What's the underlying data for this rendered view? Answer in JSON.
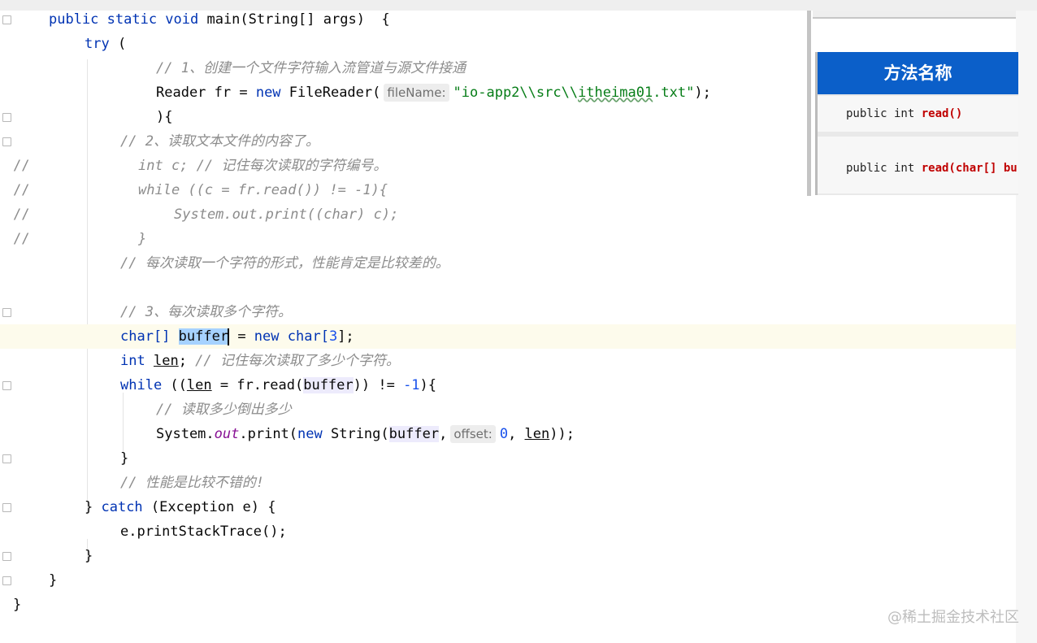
{
  "watermark": "@稀土掘金技术社区",
  "popup": {
    "header": "方法名称",
    "method1": {
      "prefix": "public int ",
      "name": "read()"
    },
    "method2": {
      "prefix": "public int ",
      "name": "read(char[] bu"
    }
  },
  "code": {
    "l1": {
      "a": "public static void ",
      "b": "main(String[] args)  {"
    },
    "l2": {
      "kw": "try",
      "rest": " ("
    },
    "l3": {
      "cm": "// 1、创建一个文件字符输入流管道与源文件接通"
    },
    "l4": {
      "a": "Reader fr = ",
      "kw": "new",
      "b": " FileReader(",
      "hint": "fileName:",
      "str_a": "\"io-app2\\\\src\\\\",
      "str_b": "itheima01",
      "str_c": ".txt\"",
      "end": ");"
    },
    "l5": {
      "a": "){"
    },
    "l6": {
      "cm": "// 2、读取文本文件的内容了。"
    },
    "l7": {
      "p": "//",
      "cm": "int c; // 记住每次读取的字符编号。"
    },
    "l8": {
      "p": "//",
      "cm": "while ((c = fr.read()) != -1){"
    },
    "l9": {
      "p": "//",
      "cm": "System.out.print((char) c);"
    },
    "l10": {
      "p": "//",
      "cm": "}"
    },
    "l11": {
      "cm": "// 每次读取一个字符的形式，性能肯定是比较差的。"
    },
    "l13": {
      "cm": "// 3、每次读取多个字符。"
    },
    "l14": {
      "a": "char[] ",
      "sel": "buffer",
      "b": " = ",
      "kw": "new",
      "c": " char[",
      "num": "3",
      "d": "];"
    },
    "l15": {
      "kw": "int",
      "sp": " ",
      "var": "len",
      "b": "; ",
      "cm": "// 记住每次读取了多少个字符。"
    },
    "l16": {
      "kw": "while",
      "a": " ((",
      "var": "len",
      "b": " = fr.read(",
      "buf": "buffer",
      "c": ")) != ",
      "num": "-1",
      "d": "){"
    },
    "l17": {
      "cm": "// 读取多少倒出多少"
    },
    "l18": {
      "a": "System.",
      "fld": "out",
      "b": ".print(",
      "kw": "new",
      "c": " String(",
      "buf": "buffer",
      "d": ",",
      "hint": "offset:",
      "num": "0",
      "e": ", ",
      "var": "len",
      "f": "));"
    },
    "l19": {
      "a": "}"
    },
    "l20": {
      "cm": "// 性能是比较不错的!"
    },
    "l21": {
      "a": "} ",
      "kw": "catch",
      "b": " (Exception e) {"
    },
    "l22": {
      "a": "e.printStackTrace();"
    },
    "l23": {
      "a": "}"
    },
    "l24": {
      "a": "}"
    },
    "l25": {
      "a": "}"
    }
  }
}
